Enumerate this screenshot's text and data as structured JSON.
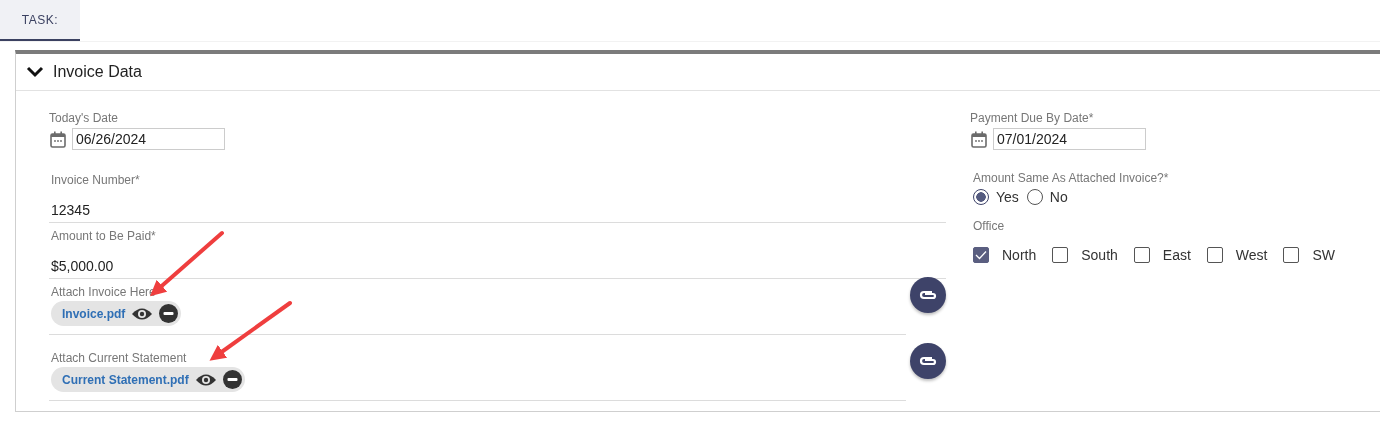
{
  "tab": {
    "label": "TASK:",
    "selected": true
  },
  "section": {
    "title": "Invoice Data",
    "expanded": true
  },
  "left_fields": [
    {
      "kind": "date",
      "label": "Today's Date",
      "value": "06/26/2024"
    },
    {
      "kind": "text",
      "label": "Invoice Number*",
      "value": "12345"
    },
    {
      "kind": "text",
      "label": "Amount to Be Paid*",
      "value": "$5,000.00"
    },
    {
      "kind": "attachment",
      "label": "Attach Invoice Here",
      "file": "Invoice.pdf"
    },
    {
      "kind": "attachment",
      "label": "Attach Current Statement",
      "file": "Current Statement.pdf"
    }
  ],
  "right_fields": [
    {
      "kind": "date",
      "label": "Payment Due By Date*",
      "value": "07/01/2024"
    },
    {
      "kind": "radio",
      "label": "Amount Same As Attached Invoice?*",
      "options": [
        {
          "label": "Yes",
          "selected": true
        },
        {
          "label": "No",
          "selected": false
        }
      ]
    },
    {
      "kind": "checkbox",
      "label": "Office",
      "options": [
        {
          "label": "North",
          "checked": true
        },
        {
          "label": "South",
          "checked": false
        },
        {
          "label": "East",
          "checked": false
        },
        {
          "label": "West",
          "checked": false
        },
        {
          "label": "SW",
          "checked": false
        }
      ]
    }
  ]
}
